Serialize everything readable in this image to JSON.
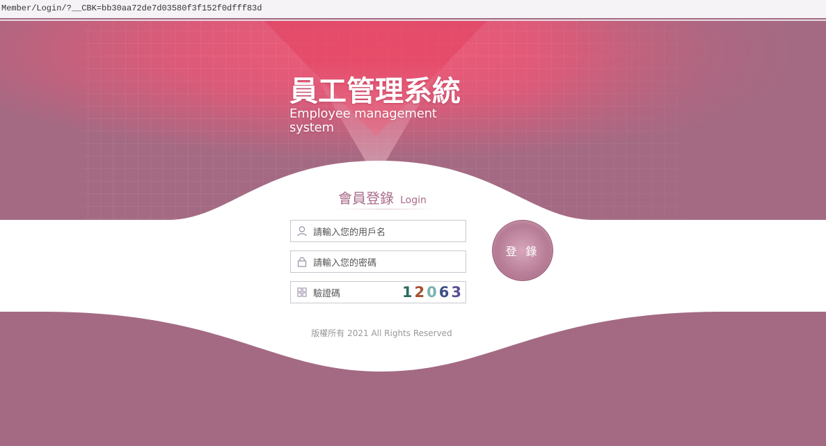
{
  "address_bar": {
    "url": "Member/Login/?__CBK=bb30aa72de7d03580f3f152f0dfff83d"
  },
  "header": {
    "title_cn": "員工管理系統",
    "title_en": "Employee management system"
  },
  "login": {
    "heading_cn": "會員登錄",
    "heading_en": "Login",
    "username_placeholder": "請輸入您的用戶名",
    "password_placeholder": "請輸入您的密碼",
    "captcha_placeholder": "驗證碼",
    "captcha_digits": [
      {
        "char": "1",
        "color": "#2f6b63"
      },
      {
        "char": "2",
        "color": "#a4502e"
      },
      {
        "char": "0",
        "color": "#78b3b0"
      },
      {
        "char": "6",
        "color": "#3d4f8a"
      },
      {
        "char": "3",
        "color": "#5a4f95"
      }
    ],
    "submit_label": "登 錄"
  },
  "footer": {
    "copyright": "版權所有 2021 All Rights Reserved"
  },
  "colors": {
    "page_background": "#a46a83",
    "banner_red": "#e0526e",
    "accent": "#a86b88"
  },
  "icons": {
    "username": "user-icon",
    "password": "lock-icon",
    "captcha": "grid-icon"
  }
}
